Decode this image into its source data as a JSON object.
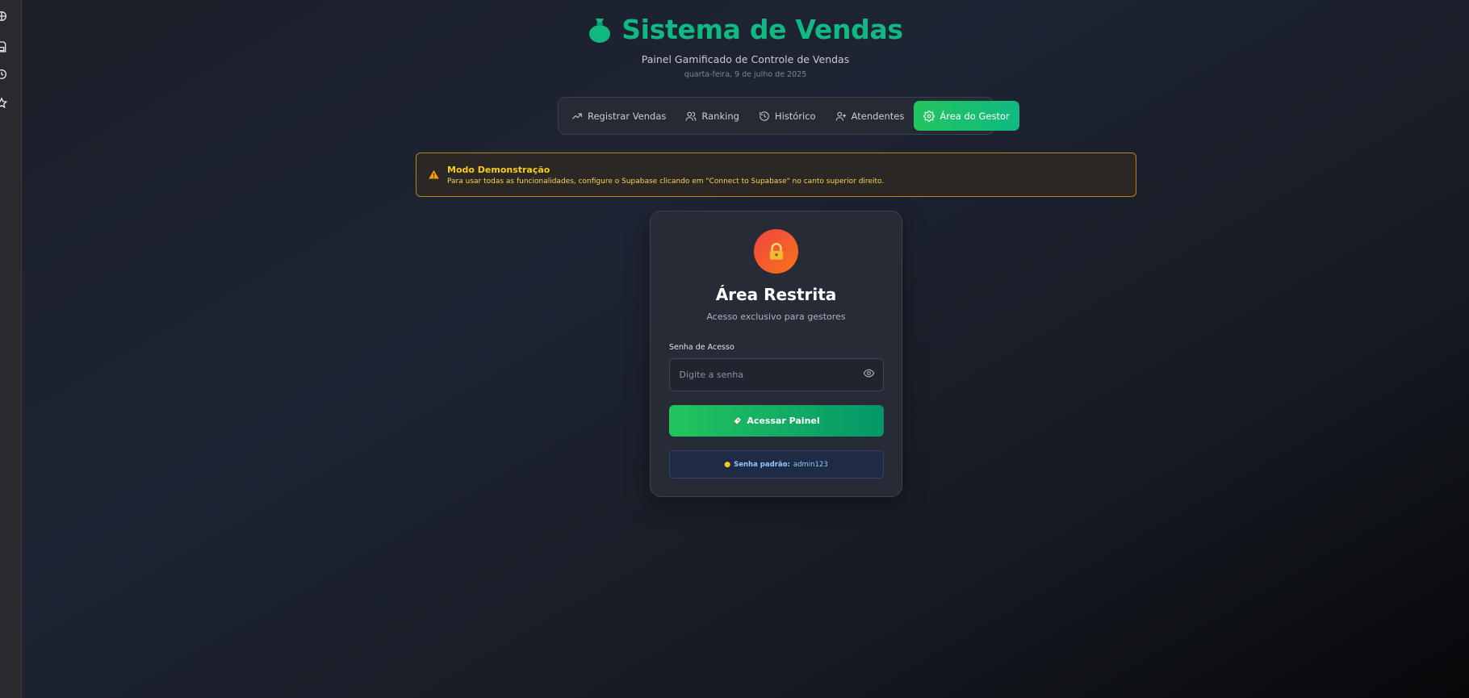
{
  "app": {
    "title": "Sistema de Vendas",
    "subtitle": "Painel Gamificado de Controle de Vendas",
    "date": "quarta-feira, 9 de julho de 2025",
    "brand_color": "#10b981"
  },
  "nav": {
    "items": [
      {
        "label": "Registrar Vendas",
        "icon": "trending-up-icon"
      },
      {
        "label": "Ranking",
        "icon": "users-icon"
      },
      {
        "label": "Histórico",
        "icon": "history-icon"
      },
      {
        "label": "Atendentes",
        "icon": "user-plus-icon"
      },
      {
        "label": "Área do Gestor",
        "icon": "gear-icon",
        "active": true
      }
    ]
  },
  "alert": {
    "title": "Modo Demonstração",
    "text": "Para usar todas as funcionalidades, configure o Supabase clicando em \"Connect to Supabase\" no canto superior direito.",
    "color": "#facc15"
  },
  "login": {
    "title": "Área Restrita",
    "subtitle": "Acesso exclusivo para gestores",
    "password_label": "Senha de Acesso",
    "password_placeholder": "Digite a senha",
    "submit_label": "Acessar Painel",
    "hint_label": "Senha padrão:",
    "hint_value": "admin123"
  }
}
